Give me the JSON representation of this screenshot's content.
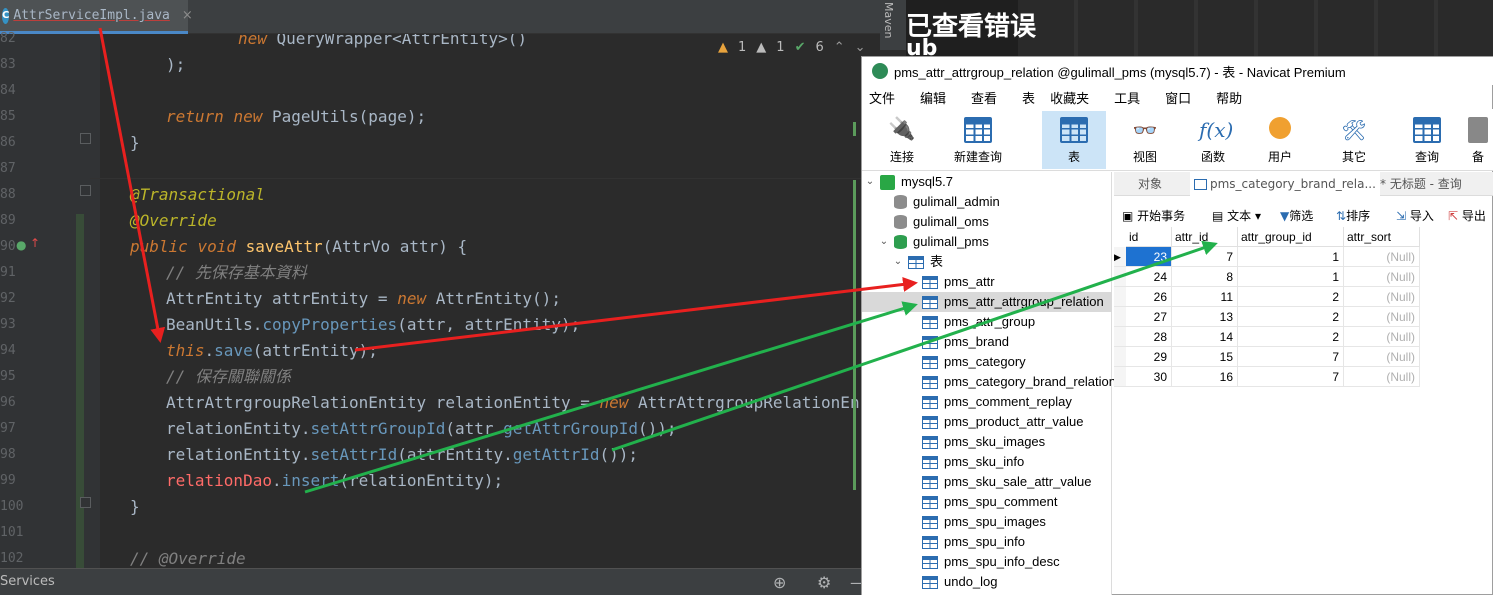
{
  "ide": {
    "tab_label": "AttrServiceImpl.java",
    "tab_icon": "C",
    "tab_close": "×",
    "side_label": "Maven",
    "inspections": {
      "warn1": "1",
      "warn2": "1",
      "ok": "6"
    },
    "status_label": "Services",
    "line_numbers": [
      "82",
      "83",
      "84",
      "85",
      "86",
      "87",
      "88",
      "89",
      "90",
      "91",
      "92",
      "93",
      "94",
      "95",
      "96",
      "97",
      "98",
      "99",
      "100",
      "101",
      "102"
    ],
    "code": {
      "l82_a": "new ",
      "l82_b": "QueryWrapper<AttrEntity>()",
      "l83": ");",
      "l85_a": "return ",
      "l85_b": "new ",
      "l85_c": "PageUtils(page);",
      "l86": "}",
      "l88": "@Transactional",
      "l89": "@Override",
      "l90_a": "public ",
      "l90_b": "void ",
      "l90_c": "saveAttr",
      "l90_d": "(AttrVo attr) {",
      "l91": "// 先保存基本資料",
      "l92_a": "AttrEntity attrEntity = ",
      "l92_b": "new ",
      "l92_c": "AttrEntity();",
      "l93_a": "BeanUtils.",
      "l93_b": "copyProperties",
      "l93_c": "(attr, attrEntity);",
      "l94_a": "this",
      "l94_b": ".",
      "l94_c": "save",
      "l94_d": "(attrEntity);",
      "l95": "// 保存關聯關係",
      "l96_a": "AttrAttrgroupRelationEntity relationEntity = ",
      "l96_b": "new ",
      "l96_c": "AttrAttrgroupRelationEntity(",
      "l97_a": "relationEntity.",
      "l97_b": "setAttrGroupId",
      "l97_c": "(attr.",
      "l97_d": "getAttrGroupId",
      "l97_e": "());",
      "l98_a": "relationEntity.",
      "l98_b": "setAttrId",
      "l98_c": "(attrEntity.",
      "l98_d": "getAttrId",
      "l98_e": "());",
      "l99_a": "relationDao",
      "l99_b": ".",
      "l99_c": "insert",
      "l99_d": "(relationEntity);",
      "l100": "}",
      "l102": "// @Override"
    }
  },
  "background": {
    "text1": "已查看错误",
    "text2": "ub"
  },
  "navicat": {
    "title": "pms_attr_attrgroup_relation @gulimall_pms (mysql5.7) - 表 - Navicat Premium",
    "menu": [
      "文件",
      "编辑",
      "查看",
      "表",
      "收藏夹",
      "工具",
      "窗口",
      "帮助"
    ],
    "toolbar": [
      "连接",
      "新建查询",
      "表",
      "视图",
      "函数",
      "用户",
      "其它",
      "查询",
      "备"
    ],
    "tree": {
      "connection": "mysql5.7",
      "databases": [
        "gulimall_admin",
        "gulimall_oms",
        "gulimall_pms"
      ],
      "tables_folder": "表",
      "tables": [
        "pms_attr",
        "pms_attr_attrgroup_relation",
        "pms_attr_group",
        "pms_brand",
        "pms_category",
        "pms_category_brand_relation",
        "pms_comment_replay",
        "pms_product_attr_value",
        "pms_sku_images",
        "pms_sku_info",
        "pms_sku_sale_attr_value",
        "pms_spu_comment",
        "pms_spu_images",
        "pms_spu_info",
        "pms_spu_info_desc",
        "undo_log"
      ],
      "selected_table": "pms_attr_attrgroup_relation"
    },
    "tabs": {
      "objects": "对象",
      "tab1": "pms_category_brand_rela...",
      "tab2": "* 无标题 - 查询"
    },
    "subtoolbar": {
      "begin_tx": "开始事务",
      "text": "文本",
      "filter": "筛选",
      "sort": "排序",
      "import": "导入",
      "export": "导出"
    },
    "grid": {
      "columns": [
        "id",
        "attr_id",
        "attr_group_id",
        "attr_sort"
      ],
      "rows": [
        [
          "23",
          "7",
          "1",
          "(Null)"
        ],
        [
          "24",
          "8",
          "1",
          "(Null)"
        ],
        [
          "26",
          "11",
          "2",
          "(Null)"
        ],
        [
          "27",
          "13",
          "2",
          "(Null)"
        ],
        [
          "28",
          "14",
          "2",
          "(Null)"
        ],
        [
          "29",
          "15",
          "7",
          "(Null)"
        ],
        [
          "30",
          "16",
          "7",
          "(Null)"
        ]
      ]
    }
  },
  "colors": {
    "red_arrow": "#e8201f",
    "green_arrow": "#22b14c",
    "accent": "#4a88c7"
  }
}
